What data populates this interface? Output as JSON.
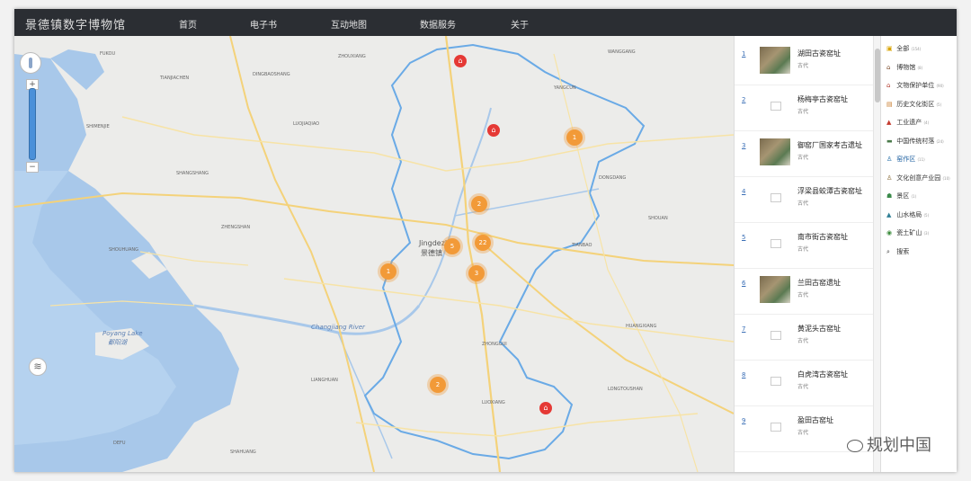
{
  "header": {
    "brand": "景德镇数字博物馆",
    "nav": [
      "首页",
      "电子书",
      "互动地图",
      "数据服务",
      "关于"
    ]
  },
  "map": {
    "clusters": [
      {
        "label": "1",
        "value": "1"
      },
      {
        "label": "2",
        "value": "2"
      },
      {
        "label": "5",
        "value": "5"
      },
      {
        "label": "22",
        "value": "22"
      },
      {
        "label": "3",
        "value": "3"
      },
      {
        "label": "1",
        "value": "1"
      },
      {
        "label": "2",
        "value": "2"
      }
    ],
    "labels": {
      "city": "Jingdezhen",
      "city_cn": "景德镇",
      "lake": "Poyang Lake",
      "lake_cn": "鄱阳湖",
      "river": "Changjiang River"
    },
    "layers_icon": "layers-icon",
    "compass_icon": "compass-icon"
  },
  "results": [
    {
      "index": "1",
      "name": "湖田古瓷窑址",
      "era": "古代",
      "thumb": "photo"
    },
    {
      "index": "2",
      "name": "杨梅亭古瓷窑址",
      "era": "古代",
      "thumb": "empty"
    },
    {
      "index": "3",
      "name": "御窑厂国家考古遗址",
      "era": "古代",
      "thumb": "photo"
    },
    {
      "index": "4",
      "name": "浮梁县蛟潭古瓷窑址",
      "era": "古代",
      "thumb": "empty"
    },
    {
      "index": "5",
      "name": "南市街古瓷窑址",
      "era": "古代",
      "thumb": "empty"
    },
    {
      "index": "6",
      "name": "兰田古窑遗址",
      "era": "古代",
      "thumb": "photo"
    },
    {
      "index": "7",
      "name": "黄泥头古窑址",
      "era": "古代",
      "thumb": "empty"
    },
    {
      "index": "8",
      "name": "白虎湾古瓷窑址",
      "era": "古代",
      "thumb": "empty"
    },
    {
      "index": "9",
      "name": "盈田古窑址",
      "era": "古代",
      "thumb": "empty"
    }
  ],
  "categories": [
    {
      "icon": "folder-icon",
      "glyph": "▣",
      "color": "#d9a400",
      "label": "全部",
      "count": "(154)"
    },
    {
      "icon": "museum-icon",
      "glyph": "⌂",
      "color": "#7b4a2a",
      "label": "博物馆",
      "count": "(8)"
    },
    {
      "icon": "heritage-icon",
      "glyph": "⌂",
      "color": "#b23a2a",
      "label": "文物保护单位",
      "count": "(90)"
    },
    {
      "icon": "district-icon",
      "glyph": "▤",
      "color": "#c77a2a",
      "label": "历史文化街区",
      "count": "(5)"
    },
    {
      "icon": "industry-icon",
      "glyph": "▲",
      "color": "#c43b2f",
      "label": "工业遗产",
      "count": "(4)"
    },
    {
      "icon": "village-icon",
      "glyph": "▬",
      "color": "#4a7a4a",
      "label": "中国传统村落",
      "count": "(24)"
    },
    {
      "icon": "kiln-icon",
      "glyph": "♙",
      "color": "#1f6aa5",
      "label": "窑作区",
      "count": "(11)"
    },
    {
      "icon": "culture-icon",
      "glyph": "♙",
      "color": "#8a6d3b",
      "label": "文化创意产业园",
      "count": "(10)"
    },
    {
      "icon": "scenic-icon",
      "glyph": "☗",
      "color": "#3b8a4a",
      "label": "景区",
      "count": "(1)"
    },
    {
      "icon": "mountain-icon",
      "glyph": "▲",
      "color": "#2f7f95",
      "label": "山水格局",
      "count": "(5)"
    },
    {
      "icon": "mine-icon",
      "glyph": "◉",
      "color": "#3a8a3a",
      "label": "瓷土矿山",
      "count": "(3)"
    },
    {
      "icon": "search-icon",
      "glyph": "⌕",
      "color": "#333333",
      "label": "搜索",
      "count": ""
    }
  ],
  "watermark": "规划中国"
}
